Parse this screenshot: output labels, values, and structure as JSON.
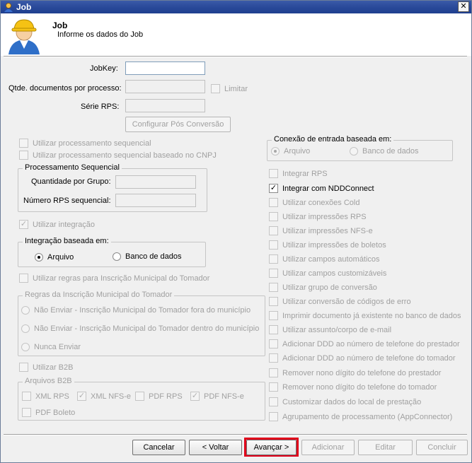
{
  "window": {
    "title": "Job",
    "close": "✕"
  },
  "header": {
    "title": "Job",
    "subtitle": "Informe os dados do Job"
  },
  "form": {
    "jobkey_label": "JobKey:",
    "jobkey_value": "",
    "qtde_label": "Qtde. documentos por processo:",
    "qtde_value": "",
    "limitar_label": "Limitar",
    "serie_label": "Série RPS:",
    "serie_value": "",
    "config_pos_button": "Configurar Pós Conversão"
  },
  "left": {
    "proc_sequencial": "Utilizar processamento sequencial",
    "proc_sequencial_cnpj": "Utilizar processamento sequencial baseado no CNPJ",
    "group_proc_seq": {
      "legend": "Processamento Sequencial",
      "qtd_label": "Quantidade por Grupo:",
      "num_label": "Número RPS sequencial:"
    },
    "utilizar_integracao": "Utilizar integração",
    "group_integracao": {
      "legend": "Integração baseada em:",
      "opt_arquivo": "Arquivo",
      "opt_banco": "Banco de dados"
    },
    "regras_im": "Utilizar regras para Inscrição Municipal do Tomador",
    "group_regras": {
      "legend": "Regras da Inscrição Municipal do Tomador",
      "opt1": "Não Enviar - Inscrição Municipal do Tomador fora do município",
      "opt2": "Não Enviar - Inscrição Municipal do Tomador dentro do município",
      "opt3": "Nunca Enviar"
    },
    "utilizar_b2b": "Utilizar B2B",
    "group_b2b": {
      "legend": "Arquivos B2B",
      "xml_rps": "XML RPS",
      "xml_nfse": "XML NFS-e",
      "pdf_rps": "PDF RPS",
      "pdf_nfse": "PDF NFS-e",
      "pdf_boleto": "PDF Boleto"
    }
  },
  "right": {
    "group_conexao": {
      "legend": "Conexão de entrada baseada em:",
      "opt_arquivo": "Arquivo",
      "opt_banco": "Banco de dados"
    },
    "options": [
      "Integrar RPS",
      "Integrar com NDDConnect",
      "Utilizar conexões Cold",
      "Utilizar impressões RPS",
      "Utilizar impressões NFS-e",
      "Utilizar impressões de boletos",
      "Utilizar campos automáticos",
      "Utilizar campos customizáveis",
      "Utilizar grupo de conversão",
      "Utilizar conversão de códigos de erro",
      "Imprimir documento já existente no banco de dados",
      "Utilizar assunto/corpo de e-mail",
      "Adicionar DDD ao número de telefone do prestador",
      "Adicionar DDD ao número de telefone do tomador",
      "Remover nono dígito do telefone do prestador",
      "Remover nono dígito do telefone do tomador",
      "Customizar dados do local de prestação",
      "Agrupamento de processamento (AppConnector)"
    ]
  },
  "footer": {
    "cancelar": "Cancelar",
    "voltar": "< Voltar",
    "avancar": "Avançar >",
    "adicionar": "Adicionar",
    "editar": "Editar",
    "concluir": "Concluir"
  },
  "colors": {
    "title_bar": "#2a4a9a",
    "highlight": "#e0001a"
  }
}
